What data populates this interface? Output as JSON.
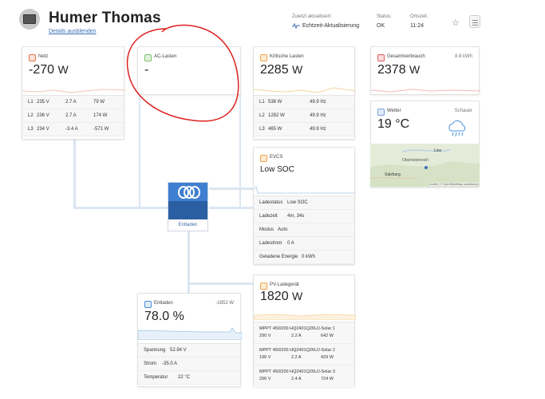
{
  "header": {
    "title": "Humer Thomas",
    "details_link": "Details ausblenden",
    "updated_label": "Zuletzt aktualisiert:",
    "updated_value": "Echtzeit-Aktualisierung",
    "status_label": "Status:",
    "status_value": "OK",
    "time_label": "Ortszeit:",
    "time_value": "11:24"
  },
  "grid": {
    "title": "Netz",
    "value": "-270",
    "unit": "W",
    "rows": [
      {
        "phase": "L1",
        "voltage": "235 V",
        "current": "2.7 A",
        "power": "79 W"
      },
      {
        "phase": "L2",
        "voltage": "236 V",
        "current": "2.7 A",
        "power": "174 W"
      },
      {
        "phase": "L3",
        "voltage": "234 V",
        "current": "-3.4 A",
        "power": "-571 W"
      }
    ]
  },
  "ac_loads": {
    "title": "AC-Lasten",
    "value": "-"
  },
  "critical": {
    "title": "Kritische Lasten",
    "value": "2285",
    "unit": "W",
    "rows": [
      {
        "phase": "L1",
        "power": "538 W",
        "freq": "49.9 Hz"
      },
      {
        "phase": "L2",
        "power": "1282 W",
        "freq": "49.9 Hz"
      },
      {
        "phase": "L3",
        "power": "465 W",
        "freq": "49.9 Hz"
      }
    ]
  },
  "total": {
    "title": "Gesamtverbrauch",
    "badge": "8.8 kWh",
    "value": "2378",
    "unit": "W"
  },
  "weather": {
    "title": "Wetter",
    "condition": "Schauer",
    "temp": "19 °C",
    "map_labels": [
      "Linz",
      "Oberösterreich",
      "Salzburg"
    ],
    "map_attr": "Leaflet | © OpenStreetMap contributors"
  },
  "evcs": {
    "title": "EVCS",
    "value": "Low SOC",
    "rows": [
      {
        "label": "Ladestatus",
        "value": "Low SOC"
      },
      {
        "label": "Ladezeit",
        "value": "4m, 34s"
      },
      {
        "label": "Modus",
        "value": "Auto"
      },
      {
        "label": "Ladestrom",
        "value": "0 A"
      },
      {
        "label": "Geladene Energie",
        "value": "0 kWh"
      }
    ]
  },
  "inverter": {
    "label": "Entladen"
  },
  "battery": {
    "title": "Entladen",
    "power": "-1852 W",
    "value": "78.0 %",
    "rows": [
      {
        "label": "Spannung",
        "value": "52.94 V"
      },
      {
        "label": "Strom",
        "value": "-35.0 A"
      },
      {
        "label": "Temperatur",
        "value": "22 °C"
      }
    ]
  },
  "pv": {
    "title": "PV-Ladegerät",
    "value": "1820",
    "unit": "W",
    "chargers": [
      {
        "name": "MPPT 450/200 HQ2401Q26UJ-Solar 1",
        "voltage": "290 V",
        "current": "2.2 A",
        "power": "642 W"
      },
      {
        "name": "MPPT 450/200 HQ2401Q26UJ-Solar 2",
        "voltage": "196 V",
        "current": "2.2 A",
        "power": "429 W"
      },
      {
        "name": "MPPT 450/200 HQ2401Q26UJ-Solar 3",
        "voltage": "296 V",
        "current": "2.4 A",
        "power": "724 W"
      }
    ]
  },
  "colors": {
    "accent": "#3d6fb5",
    "grid": "#e8734a",
    "ac": "#7bbf6a",
    "critical": "#f0a64a",
    "total": "#e25c5c",
    "battery": "#4a90d9"
  }
}
